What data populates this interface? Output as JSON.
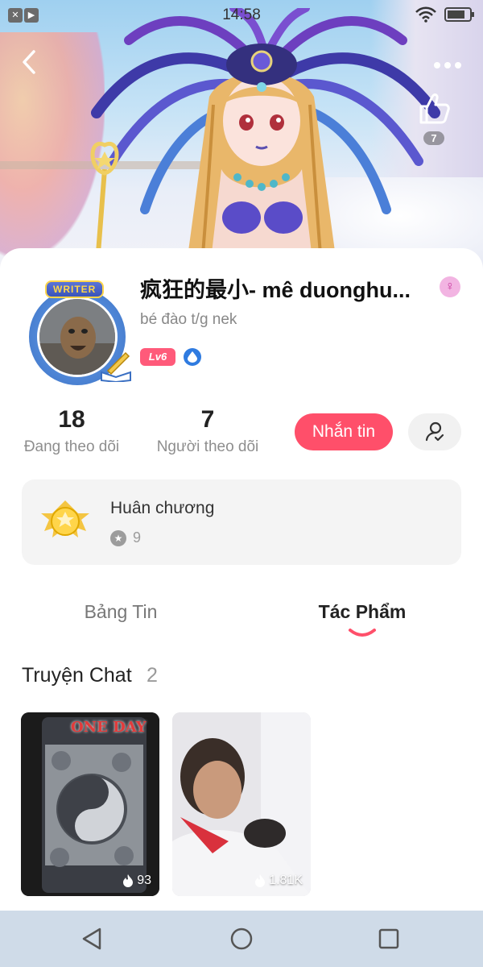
{
  "status_bar": {
    "time": "14:58",
    "battery_level": 0.8
  },
  "header": {
    "like_count": "7"
  },
  "profile": {
    "avatar_badge": "WRITER",
    "username": "疯狂的最小- mê duonghu...",
    "bio": "bé đào t/g nek",
    "level": "Lv6"
  },
  "stats": {
    "following": {
      "value": "18",
      "label": "Đang theo dõi"
    },
    "followers": {
      "value": "7",
      "label": "Người theo dõi"
    }
  },
  "actions": {
    "message_label": "Nhắn tin"
  },
  "medals": {
    "title": "Huân chương",
    "count": "9"
  },
  "tabs": [
    {
      "label": "Bảng Tin",
      "active": false
    },
    {
      "label": "Tác Phẩm",
      "active": true
    }
  ],
  "section": {
    "title": "Truyện Chat",
    "count": "2"
  },
  "stories": [
    {
      "cover_title": "ONE DAY",
      "views": "93"
    },
    {
      "views": "1.81K"
    }
  ],
  "colors": {
    "accent": "#ff4f6a",
    "level_badge": "#ff5a7a",
    "navbar": "#cfdbe8"
  }
}
